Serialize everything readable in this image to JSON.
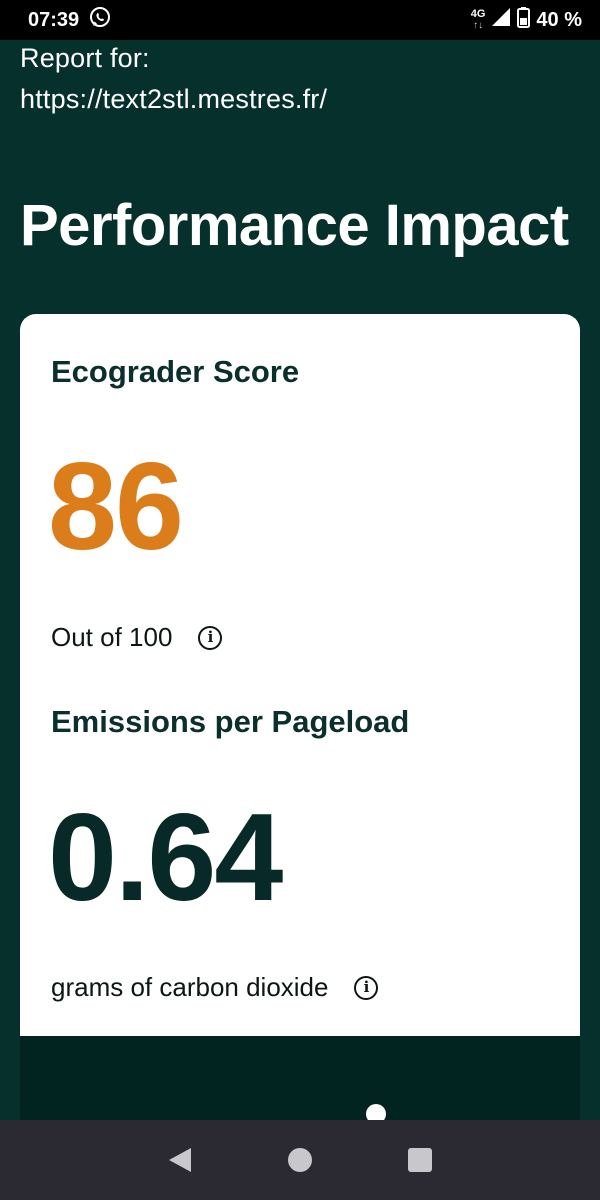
{
  "status_bar": {
    "time": "07:39",
    "network": "4G",
    "network_arrows": "↑↓",
    "battery": "40 %"
  },
  "header": {
    "report_for": "Report for:",
    "url": "https://text2stl.mestres.fr/",
    "title": "Performance Impact"
  },
  "card": {
    "score_heading": "Ecograder Score",
    "score_value": "86",
    "score_caption": "Out of 100",
    "emissions_heading": "Emissions per Pageload",
    "emissions_value": "0.64",
    "emissions_caption": "grams of carbon dioxide"
  },
  "colors": {
    "background": "#06302c",
    "score_accent": "#dc7d1b",
    "emissions_number": "#072927"
  }
}
